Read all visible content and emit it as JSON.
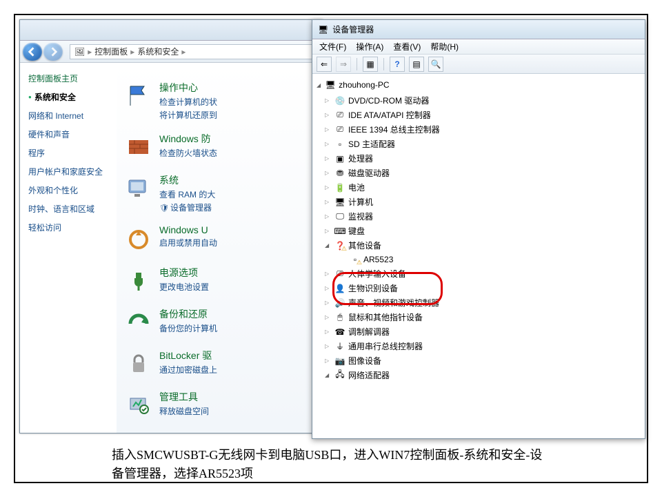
{
  "control_panel": {
    "breadcrumb": {
      "p1": "控制面板",
      "p2": "系统和安全"
    },
    "side_head": "控制面板主页",
    "side": [
      "系统和安全",
      "网络和 Internet",
      "硬件和声音",
      "程序",
      "用户帐户和家庭安全",
      "外观和个性化",
      "时钟、语言和区域",
      "轻松访问"
    ],
    "cats": [
      {
        "title": "操作中心",
        "links": [
          "检查计算机的状",
          "将计算机还原到"
        ]
      },
      {
        "title": "Windows 防",
        "links": [
          "检查防火墙状态"
        ]
      },
      {
        "title": "系统",
        "links": [
          "查看 RAM 的大",
          "设备管理器"
        ],
        "shield": [
          false,
          true
        ]
      },
      {
        "title": "Windows U",
        "links": [
          "启用或禁用自动"
        ]
      },
      {
        "title": "电源选项",
        "links": [
          "更改电池设置"
        ]
      },
      {
        "title": "备份和还原",
        "links": [
          "备份您的计算机"
        ]
      },
      {
        "title": "BitLocker 驱",
        "links": [
          "通过加密磁盘上"
        ]
      },
      {
        "title": "管理工具",
        "links": [
          "释放磁盘空间"
        ]
      }
    ]
  },
  "device_manager": {
    "title": "设备管理器",
    "menu": [
      "文件(F)",
      "操作(A)",
      "查看(V)",
      "帮助(H)"
    ],
    "root": "zhouhong-PC",
    "items": [
      "DVD/CD-ROM 驱动器",
      "IDE ATA/ATAPI 控制器",
      "IEEE 1394 总线主控制器",
      "SD 主适配器",
      "处理器",
      "磁盘驱动器",
      "电池",
      "计算机",
      "监视器",
      "键盘"
    ],
    "other_label": "其他设备",
    "other_child": "AR5523",
    "items2": [
      "人体学输入设备",
      "生物识别设备",
      "声音、视频和游戏控制器",
      "鼠标和其他指针设备",
      "调制解调器",
      "通用串行总线控制器",
      "图像设备",
      "网络适配器"
    ]
  },
  "caption": "插入SMCWUSBT-G无线网卡到电脑USB口，进入WIN7控制面板-系统和安全-设备管理器，选择AR5523项"
}
